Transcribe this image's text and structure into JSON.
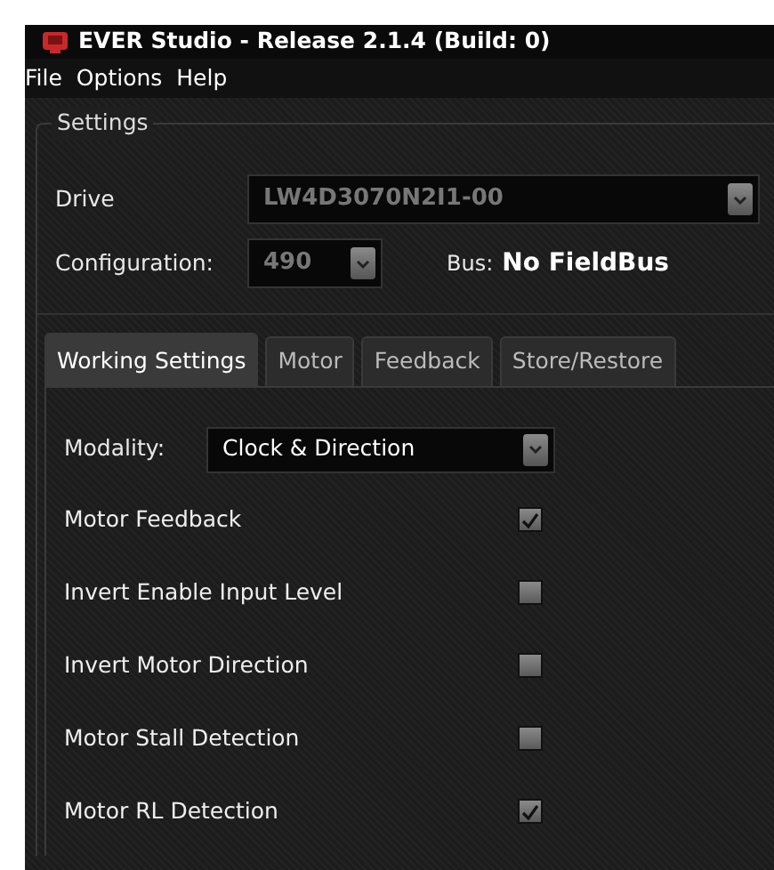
{
  "window": {
    "title": "EVER Studio - Release 2.1.4  (Build: 0)"
  },
  "menu": [
    "File",
    "Options",
    "Help"
  ],
  "settings": {
    "legend": "Settings",
    "drive_label": "Drive",
    "drive_value": "LW4D3070N2I1-00",
    "configuration_label": "Configuration:",
    "configuration_value": "490",
    "bus_label": "Bus:",
    "bus_value": "No FieldBus"
  },
  "tabs": [
    {
      "label": "Working Settings",
      "selected": true
    },
    {
      "label": "Motor",
      "selected": false
    },
    {
      "label": "Feedback",
      "selected": false
    },
    {
      "label": "Store/Restore",
      "selected": false
    }
  ],
  "modality": {
    "label": "Modality:",
    "value": "Clock & Direction"
  },
  "options": [
    {
      "label": "Motor Feedback",
      "checked": true
    },
    {
      "label": "Invert Enable Input Level",
      "checked": false
    },
    {
      "label": "Invert Motor Direction",
      "checked": false
    },
    {
      "label": "Motor Stall Detection",
      "checked": false
    },
    {
      "label": "Motor RL Detection",
      "checked": true
    }
  ]
}
